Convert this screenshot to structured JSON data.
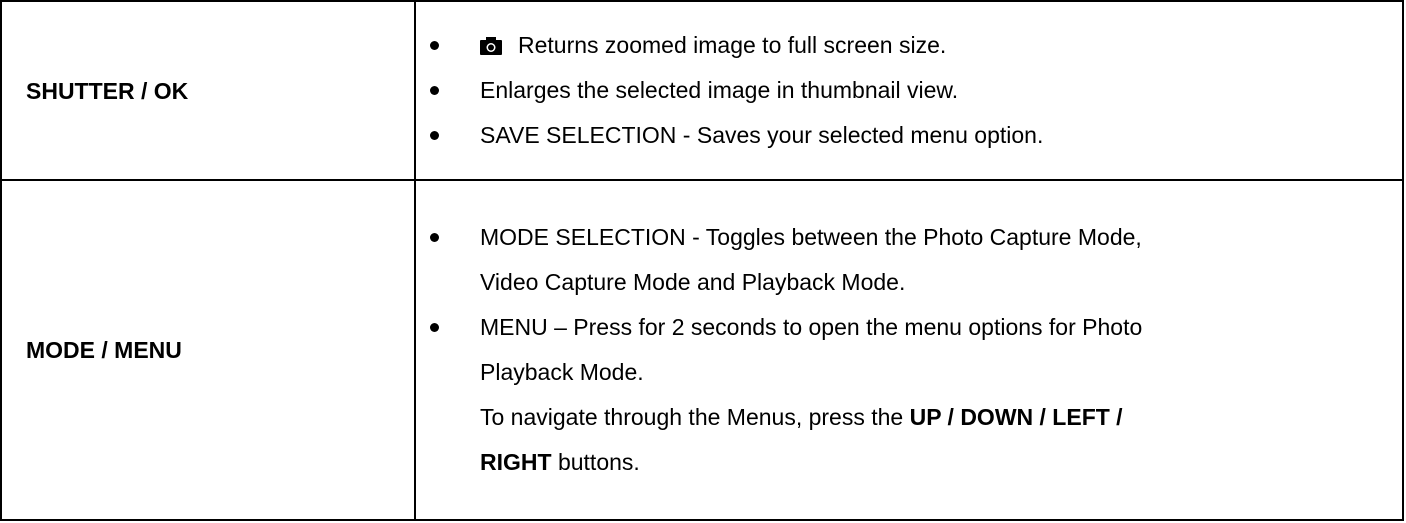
{
  "rows": [
    {
      "key": "SHUTTER / OK",
      "items": [
        "Returns zoomed image to full screen size.",
        "Enlarges the selected image in thumbnail view.",
        "SAVE SELECTION - Saves your selected menu option."
      ]
    },
    {
      "key": "MODE / MENU",
      "items": [
        {
          "line1": "MODE SELECTION - Toggles between the Photo Capture Mode,",
          "line2": "Video Capture Mode and Playback Mode."
        },
        {
          "line1": "MENU – Press for 2 seconds to open the menu options for Photo",
          "line2": "Playback Mode."
        }
      ],
      "note": {
        "text1": "To navigate through the Menus, press the ",
        "bold1": "UP / DOWN / LEFT /",
        "bold2": "RIGHT",
        "text2": " buttons."
      }
    }
  ],
  "icons": {
    "item_1_icon": "camera-icon"
  }
}
